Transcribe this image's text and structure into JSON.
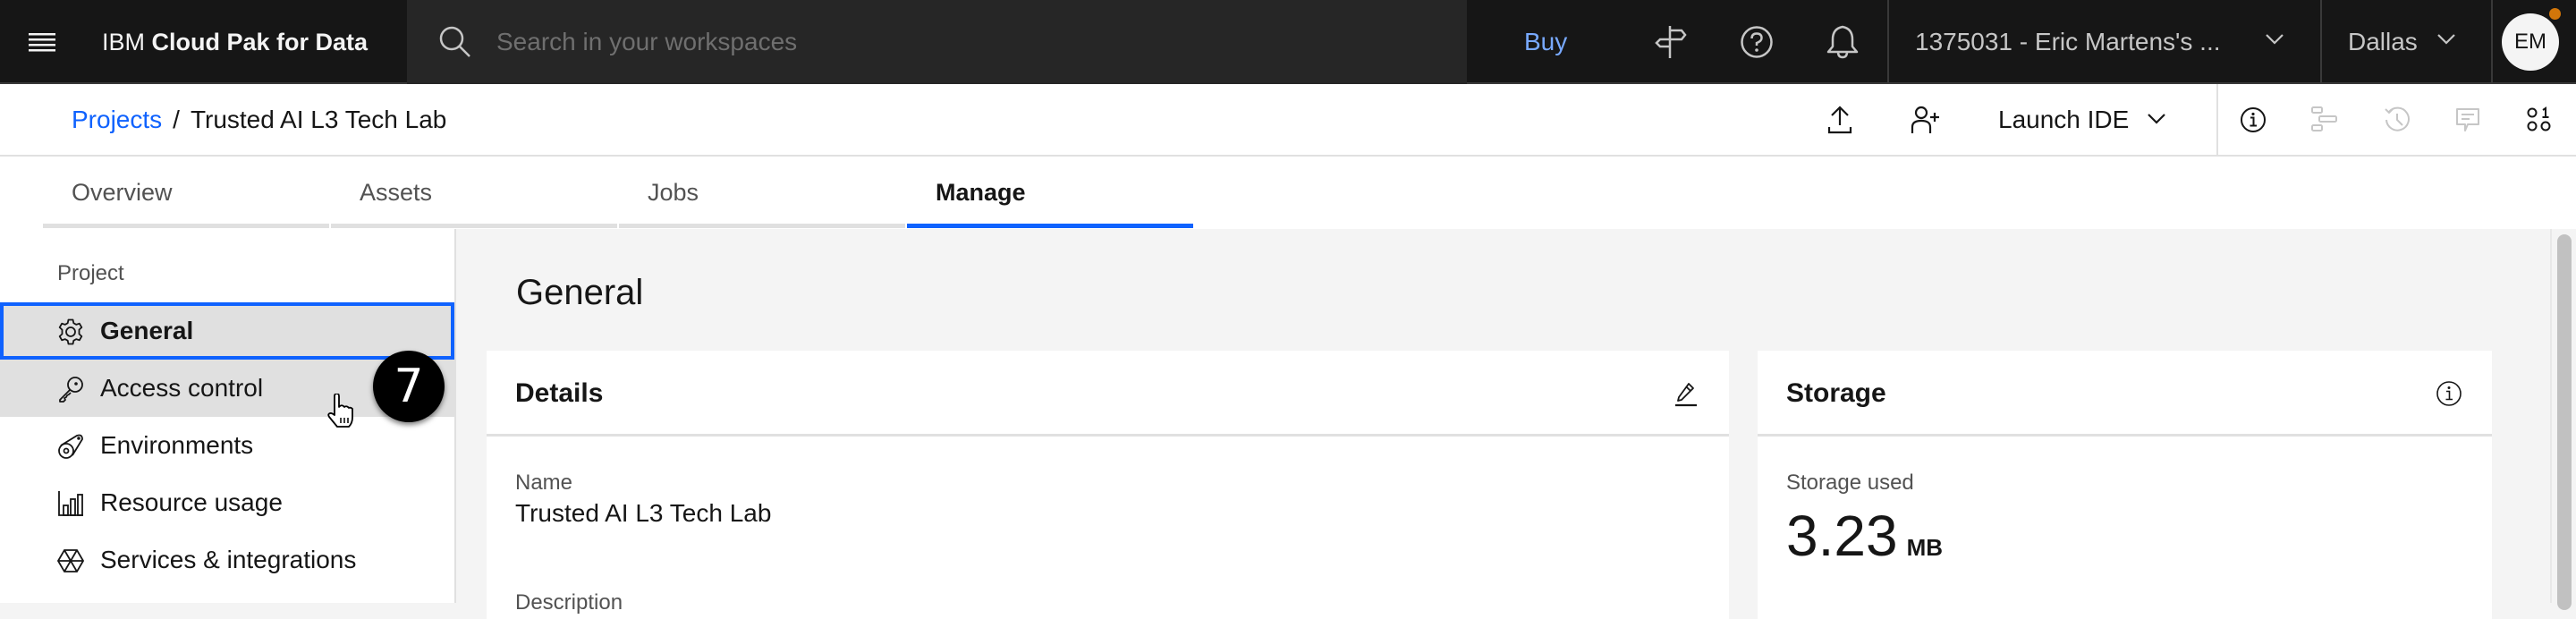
{
  "header": {
    "brand_prefix": "IBM",
    "brand_name": "Cloud Pak for Data",
    "search_placeholder": "Search in your workspaces",
    "buy_label": "Buy",
    "account_label": "1375031 - Eric Martens's ...",
    "region_label": "Dallas",
    "avatar_initials": "EM",
    "icons": [
      "menu-icon",
      "search-icon",
      "signpost-icon",
      "help-icon",
      "notification-icon",
      "chevron-down-icon"
    ]
  },
  "subheader": {
    "breadcrumb": [
      {
        "label": "Projects",
        "link": true
      },
      {
        "label": "Trusted AI L3 Tech Lab",
        "link": false
      }
    ],
    "breadcrumb_separator": "/",
    "launch_ide_label": "Launch IDE",
    "toolbar_icons": [
      "upload-icon",
      "add-collaborator-icon",
      "info-icon",
      "jobs-gantt-icon",
      "history-icon",
      "comment-icon",
      "data-binary-icon"
    ]
  },
  "tabs": [
    {
      "label": "Overview",
      "active": false
    },
    {
      "label": "Assets",
      "active": false
    },
    {
      "label": "Jobs",
      "active": false
    },
    {
      "label": "Manage",
      "active": true
    }
  ],
  "sidebar": {
    "section_label": "Project",
    "items": [
      {
        "label": "General",
        "icon": "settings-icon",
        "selected": true
      },
      {
        "label": "Access control",
        "icon": "key-icon",
        "selected": false,
        "hovered": true
      },
      {
        "label": "Environments",
        "icon": "environment-icon",
        "selected": false
      },
      {
        "label": "Resource usage",
        "icon": "bar-chart-icon",
        "selected": false
      },
      {
        "label": "Services & integrations",
        "icon": "services-icon",
        "selected": false
      }
    ]
  },
  "overlay": {
    "step_badge": "7"
  },
  "main": {
    "page_title": "General",
    "details_card": {
      "title": "Details",
      "action_icon": "edit-icon",
      "fields": [
        {
          "label": "Name",
          "value": "Trusted AI L3 Tech Lab"
        },
        {
          "label": "Description",
          "value": ""
        }
      ]
    },
    "storage_card": {
      "title": "Storage",
      "action_icon": "info-icon",
      "storage_used_label": "Storage used",
      "storage_used_value": "3.23",
      "storage_used_unit": "MB"
    }
  },
  "colors": {
    "accent": "#0f62fe",
    "header_bg": "#161616",
    "search_bg": "#262626",
    "buy_link": "#78a9ff",
    "notification_dot": "#d2760a"
  }
}
